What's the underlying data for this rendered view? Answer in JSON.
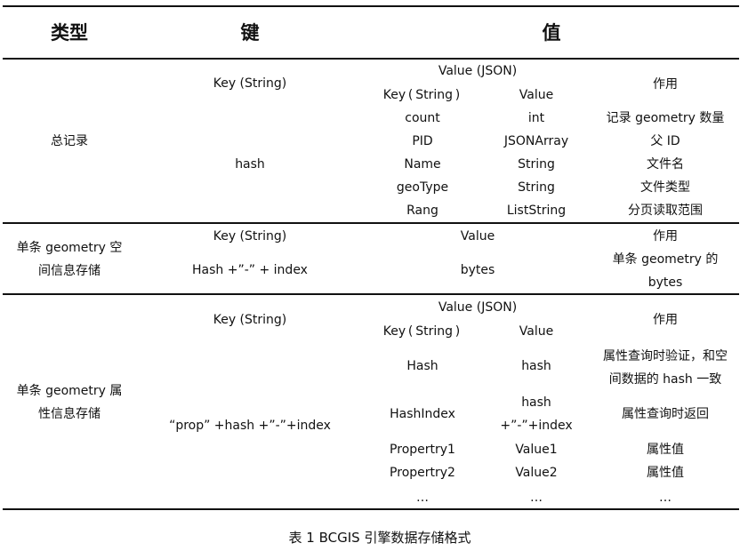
{
  "table": {
    "headers": {
      "type": "类型",
      "key": "键",
      "value": "值"
    },
    "rows": [
      {
        "type": "总记录",
        "key_header": "Key (String)",
        "key_value": "hash",
        "value_header": "Value (JSON)",
        "sub_key_header": "Key ( String )",
        "sub_value_header": "Value",
        "role_header": "作用",
        "items": [
          {
            "key": "count",
            "value": "int",
            "role": "记录 geometry 数量"
          },
          {
            "key": "PID",
            "value": "JSONArray",
            "role": "父 ID"
          },
          {
            "key": "Name",
            "value": "String",
            "role": "文件名"
          },
          {
            "key": "geoType",
            "value": "String",
            "role": "文件类型"
          },
          {
            "key": "Rang",
            "value": "ListString",
            "role": "分页读取范围"
          }
        ]
      },
      {
        "type_line1": "单条 geometry 空",
        "type_line2": "间信息存储",
        "key_header": "Key (String)",
        "key_value": "Hash +”-” + index",
        "value_header": "Value",
        "value_value": "bytes",
        "role_header": "作用",
        "role_line1": "单条 geometry 的",
        "role_line2": "bytes"
      },
      {
        "type_line1": "单条 geometry 属",
        "type_line2": "性信息存储",
        "key_header": "Key (String)",
        "key_value": "“prop” +hash +”-”+index",
        "value_header": "Value (JSON)",
        "sub_key_header": "Key ( String )",
        "sub_value_header": "Value",
        "role_header": "作用",
        "items": [
          {
            "key": "Hash",
            "value": "hash",
            "role_line1": "属性查询时验证，和空",
            "role_line2": "间数据的 hash 一致"
          },
          {
            "key": "HashIndex",
            "value_line1": "hash",
            "value_line2": "+”-”+index",
            "role": "属性查询时返回"
          },
          {
            "key": "Propertry1",
            "value": "Value1",
            "role": "属性值"
          },
          {
            "key": "Propertry2",
            "value": "Value2",
            "role": "属性值"
          },
          {
            "key": "…",
            "value": "…",
            "role": "…"
          }
        ]
      }
    ]
  },
  "caption": "表 1 BCGIS 引擎数据存储格式"
}
